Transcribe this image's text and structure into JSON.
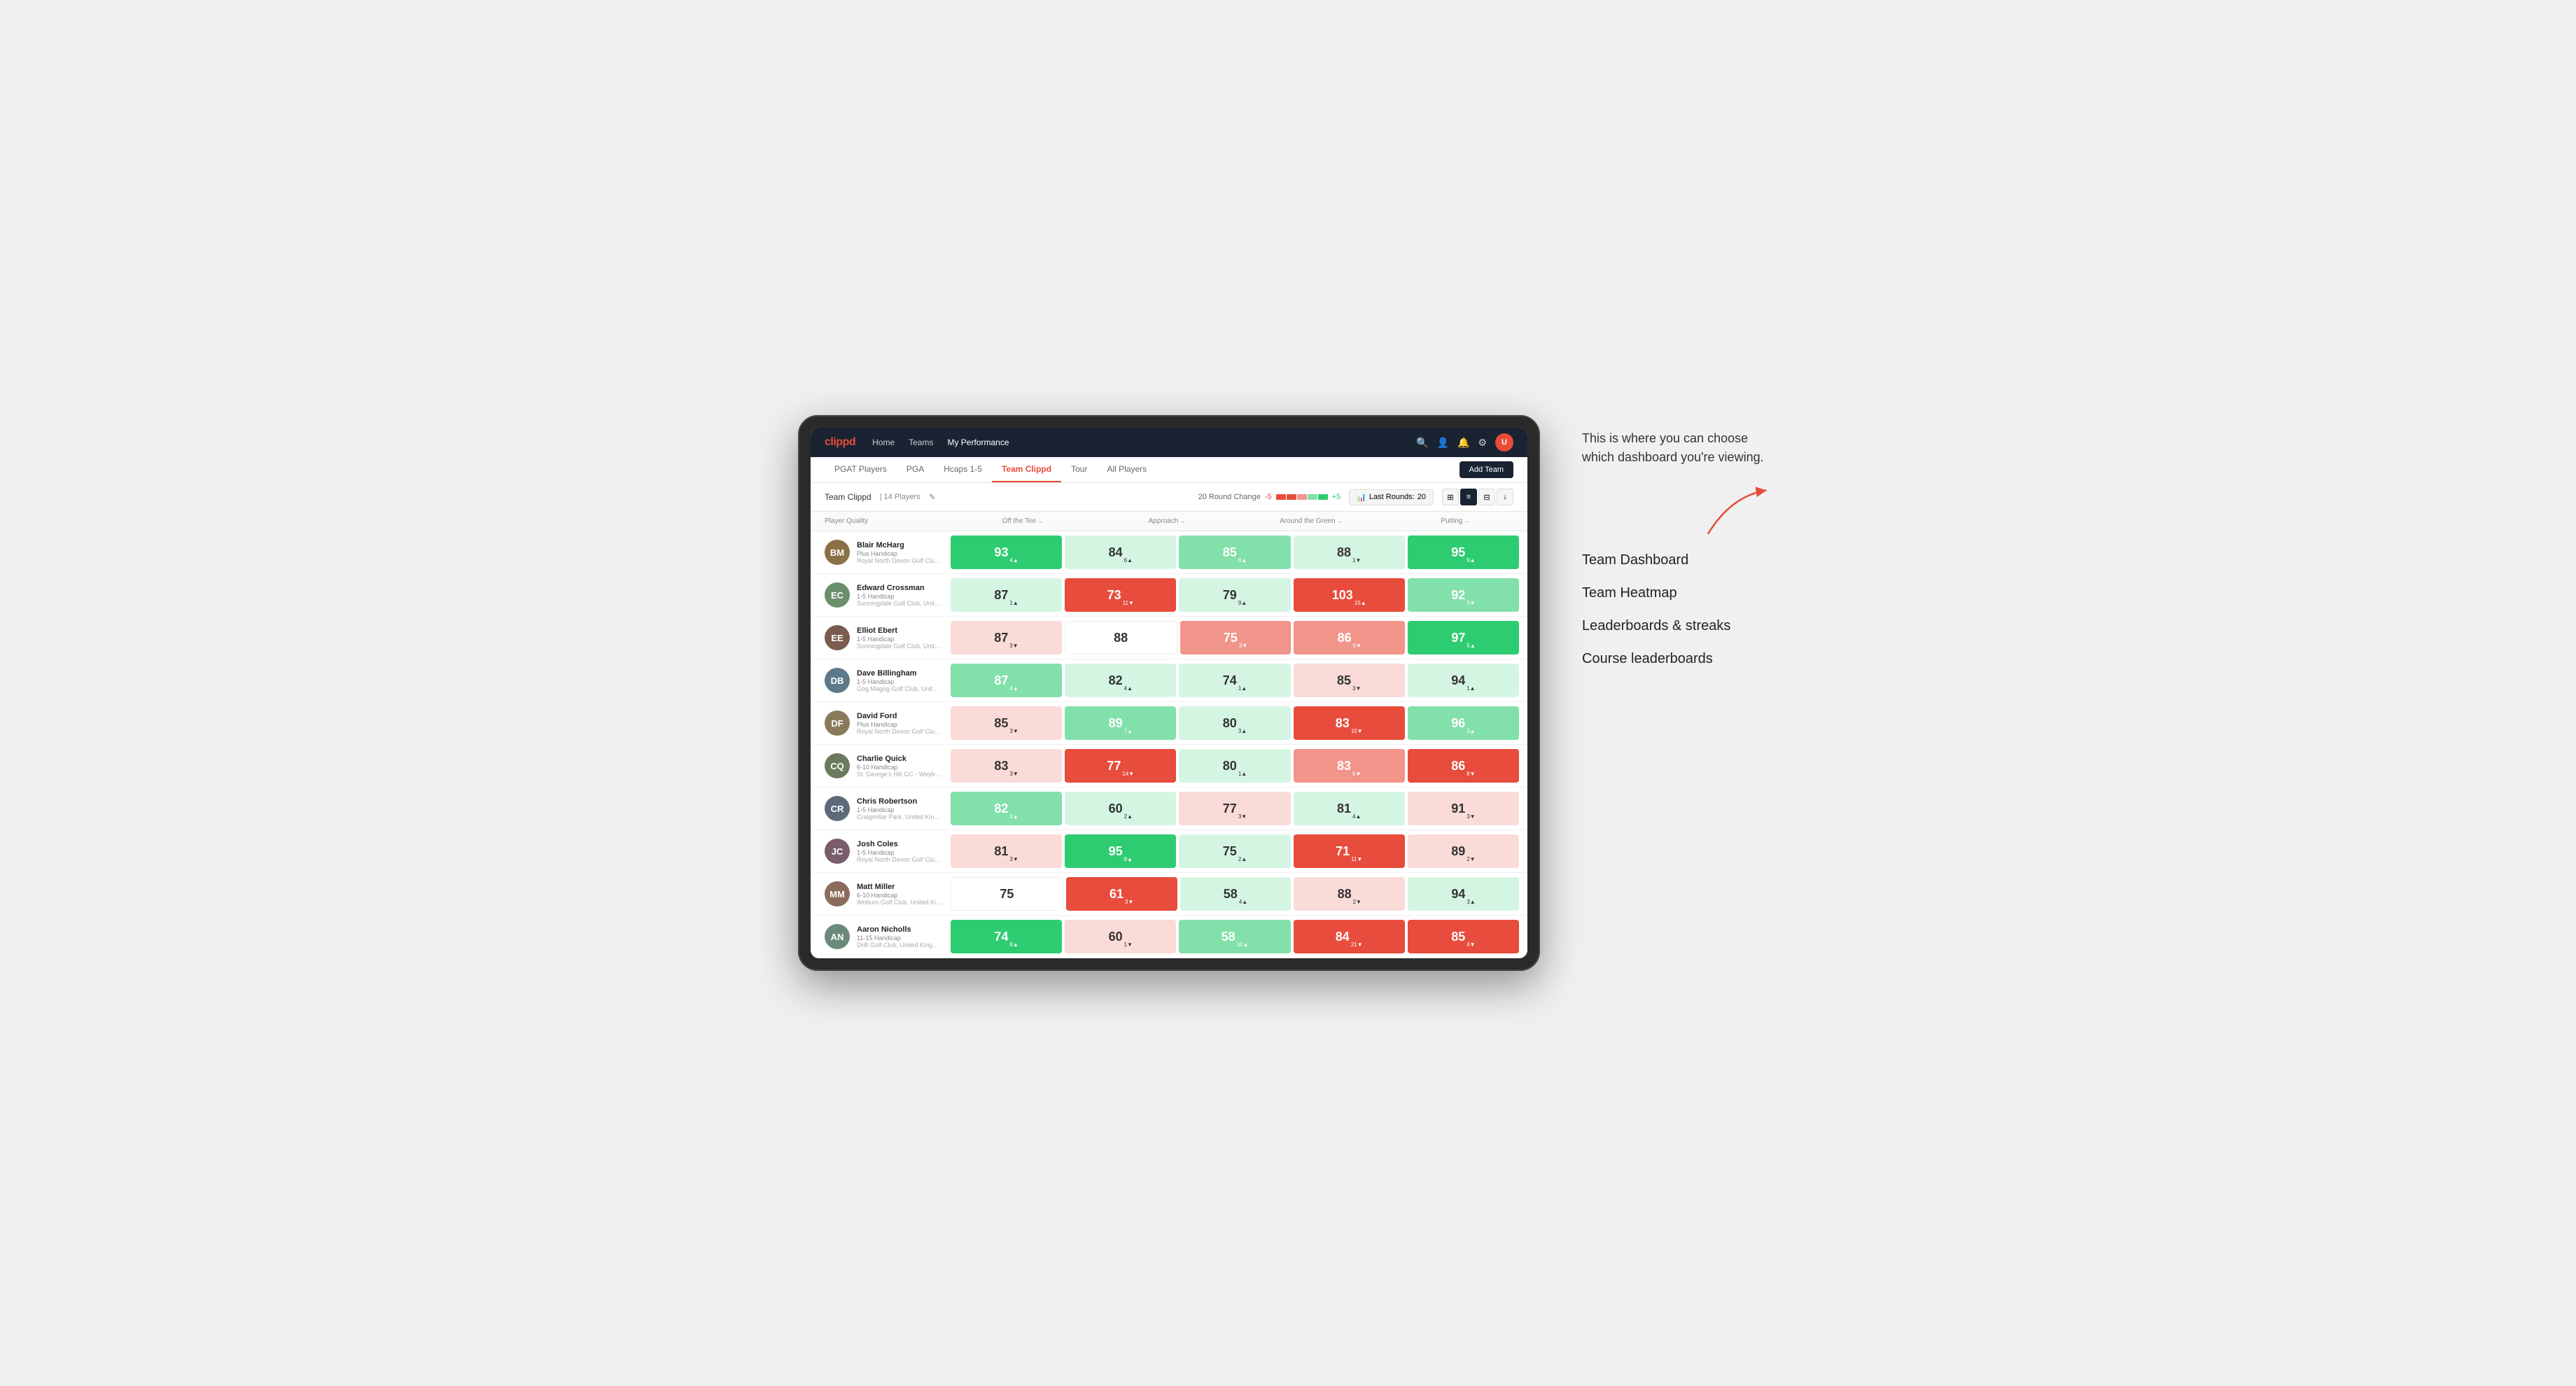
{
  "annotation": {
    "intro": "This is where you can choose which dashboard you're viewing.",
    "items": [
      "Team Dashboard",
      "Team Heatmap",
      "Leaderboards & streaks",
      "Course leaderboards"
    ]
  },
  "nav": {
    "logo": "clippd",
    "items": [
      "Home",
      "Teams",
      "My Performance"
    ],
    "active": "My Performance"
  },
  "sub_nav": {
    "items": [
      "PGAT Players",
      "PGA",
      "Hcaps 1-5",
      "Team Clippd",
      "Tour",
      "All Players"
    ],
    "active": "Team Clippd",
    "add_button": "Add Team"
  },
  "team_bar": {
    "name": "Team Clippd",
    "separator": "|",
    "count": "14 Players",
    "round_change_label": "20 Round Change",
    "round_change_value": "-5",
    "round_change_positive": "+5",
    "last_rounds_label": "Last Rounds:",
    "last_rounds_value": "20"
  },
  "table": {
    "columns": {
      "player": "Player Quality",
      "off_tee": "Off the Tee",
      "approach": "Approach",
      "around_green": "Around the Green",
      "putting": "Putting"
    },
    "rows": [
      {
        "name": "Blair McHarg",
        "handicap": "Plus Handicap",
        "club": "Royal North Devon Golf Club, United Kingdom",
        "initials": "BM",
        "bg": "#8B6F47",
        "player_quality": {
          "value": "93",
          "change": "4",
          "dir": "up",
          "color": "green-dark"
        },
        "off_tee": {
          "value": "84",
          "change": "6",
          "dir": "up",
          "color": "green-light"
        },
        "approach": {
          "value": "85",
          "change": "8",
          "dir": "up",
          "color": "green-med"
        },
        "around_green": {
          "value": "88",
          "change": "1",
          "dir": "down",
          "color": "green-light"
        },
        "putting": {
          "value": "95",
          "change": "9",
          "dir": "up",
          "color": "green-dark"
        }
      },
      {
        "name": "Edward Crossman",
        "handicap": "1-5 Handicap",
        "club": "Sunningdale Golf Club, United Kingdom",
        "initials": "EC",
        "bg": "#6B8E6B",
        "player_quality": {
          "value": "87",
          "change": "1",
          "dir": "up",
          "color": "green-light"
        },
        "off_tee": {
          "value": "73",
          "change": "11",
          "dir": "down",
          "color": "red-dark"
        },
        "approach": {
          "value": "79",
          "change": "9",
          "dir": "up",
          "color": "green-light"
        },
        "around_green": {
          "value": "103",
          "change": "15",
          "dir": "up",
          "color": "red-dark"
        },
        "putting": {
          "value": "92",
          "change": "3",
          "dir": "down",
          "color": "green-med"
        }
      },
      {
        "name": "Elliot Ebert",
        "handicap": "1-5 Handicap",
        "club": "Sunningdale Golf Club, United Kingdom",
        "initials": "EE",
        "bg": "#7A5C4F",
        "player_quality": {
          "value": "87",
          "change": "3",
          "dir": "down",
          "color": "red-light"
        },
        "off_tee": {
          "value": "88",
          "change": "",
          "dir": "",
          "color": "neutral"
        },
        "approach": {
          "value": "75",
          "change": "3",
          "dir": "down",
          "color": "red-med"
        },
        "around_green": {
          "value": "86",
          "change": "6",
          "dir": "down",
          "color": "red-med"
        },
        "putting": {
          "value": "97",
          "change": "5",
          "dir": "up",
          "color": "green-dark"
        }
      },
      {
        "name": "Dave Billingham",
        "handicap": "1-5 Handicap",
        "club": "Gog Magog Golf Club, United Kingdom",
        "initials": "DB",
        "bg": "#5C7A8A",
        "player_quality": {
          "value": "87",
          "change": "4",
          "dir": "up",
          "color": "green-med"
        },
        "off_tee": {
          "value": "82",
          "change": "4",
          "dir": "up",
          "color": "green-light"
        },
        "approach": {
          "value": "74",
          "change": "1",
          "dir": "up",
          "color": "green-light"
        },
        "around_green": {
          "value": "85",
          "change": "3",
          "dir": "down",
          "color": "red-light"
        },
        "putting": {
          "value": "94",
          "change": "1",
          "dir": "up",
          "color": "green-light"
        }
      },
      {
        "name": "David Ford",
        "handicap": "Plus Handicap",
        "club": "Royal North Devon Golf Club, United Kingdom",
        "initials": "DF",
        "bg": "#8A7A5C",
        "player_quality": {
          "value": "85",
          "change": "3",
          "dir": "down",
          "color": "red-light"
        },
        "off_tee": {
          "value": "89",
          "change": "7",
          "dir": "up",
          "color": "green-med"
        },
        "approach": {
          "value": "80",
          "change": "3",
          "dir": "up",
          "color": "green-light"
        },
        "around_green": {
          "value": "83",
          "change": "10",
          "dir": "down",
          "color": "red-dark"
        },
        "putting": {
          "value": "96",
          "change": "3",
          "dir": "up",
          "color": "green-med"
        }
      },
      {
        "name": "Charlie Quick",
        "handicap": "6-10 Handicap",
        "club": "St. George's Hill GC - Weybridge, Surrey, Uni...",
        "initials": "CQ",
        "bg": "#6B7A5C",
        "player_quality": {
          "value": "83",
          "change": "3",
          "dir": "down",
          "color": "red-light"
        },
        "off_tee": {
          "value": "77",
          "change": "14",
          "dir": "down",
          "color": "red-dark"
        },
        "approach": {
          "value": "80",
          "change": "1",
          "dir": "up",
          "color": "green-light"
        },
        "around_green": {
          "value": "83",
          "change": "6",
          "dir": "down",
          "color": "red-med"
        },
        "putting": {
          "value": "86",
          "change": "8",
          "dir": "down",
          "color": "red-dark"
        }
      },
      {
        "name": "Chris Robertson",
        "handicap": "1-5 Handicap",
        "club": "Craigmillar Park, United Kingdom",
        "initials": "CR",
        "bg": "#5C6B7A",
        "player_quality": {
          "value": "82",
          "change": "3",
          "dir": "up",
          "color": "green-med"
        },
        "off_tee": {
          "value": "60",
          "change": "2",
          "dir": "up",
          "color": "green-light"
        },
        "approach": {
          "value": "77",
          "change": "3",
          "dir": "down",
          "color": "red-light"
        },
        "around_green": {
          "value": "81",
          "change": "4",
          "dir": "up",
          "color": "green-light"
        },
        "putting": {
          "value": "91",
          "change": "3",
          "dir": "down",
          "color": "red-light"
        }
      },
      {
        "name": "Josh Coles",
        "handicap": "1-5 Handicap",
        "club": "Royal North Devon Golf Club, United Kingdom",
        "initials": "JC",
        "bg": "#7A5C6B",
        "player_quality": {
          "value": "81",
          "change": "3",
          "dir": "down",
          "color": "red-light"
        },
        "off_tee": {
          "value": "95",
          "change": "8",
          "dir": "up",
          "color": "green-dark"
        },
        "approach": {
          "value": "75",
          "change": "2",
          "dir": "up",
          "color": "green-light"
        },
        "around_green": {
          "value": "71",
          "change": "11",
          "dir": "down",
          "color": "red-dark"
        },
        "putting": {
          "value": "89",
          "change": "2",
          "dir": "down",
          "color": "red-light"
        }
      },
      {
        "name": "Matt Miller",
        "handicap": "6-10 Handicap",
        "club": "Woburn Golf Club, United Kingdom",
        "initials": "MM",
        "bg": "#8A6B5C",
        "player_quality": {
          "value": "75",
          "change": "",
          "dir": "",
          "color": "neutral"
        },
        "off_tee": {
          "value": "61",
          "change": "3",
          "dir": "down",
          "color": "red-dark"
        },
        "approach": {
          "value": "58",
          "change": "4",
          "dir": "up",
          "color": "green-light"
        },
        "around_green": {
          "value": "88",
          "change": "2",
          "dir": "down",
          "color": "red-light"
        },
        "putting": {
          "value": "94",
          "change": "3",
          "dir": "up",
          "color": "green-light"
        }
      },
      {
        "name": "Aaron Nicholls",
        "handicap": "11-15 Handicap",
        "club": "Drift Golf Club, United Kingdom",
        "initials": "AN",
        "bg": "#6B8A7A",
        "player_quality": {
          "value": "74",
          "change": "8",
          "dir": "up",
          "color": "green-dark"
        },
        "off_tee": {
          "value": "60",
          "change": "1",
          "dir": "down",
          "color": "red-light"
        },
        "approach": {
          "value": "58",
          "change": "10",
          "dir": "up",
          "color": "green-med"
        },
        "around_green": {
          "value": "84",
          "change": "21",
          "dir": "down",
          "color": "red-dark"
        },
        "putting": {
          "value": "85",
          "change": "4",
          "dir": "down",
          "color": "red-dark"
        }
      }
    ]
  }
}
